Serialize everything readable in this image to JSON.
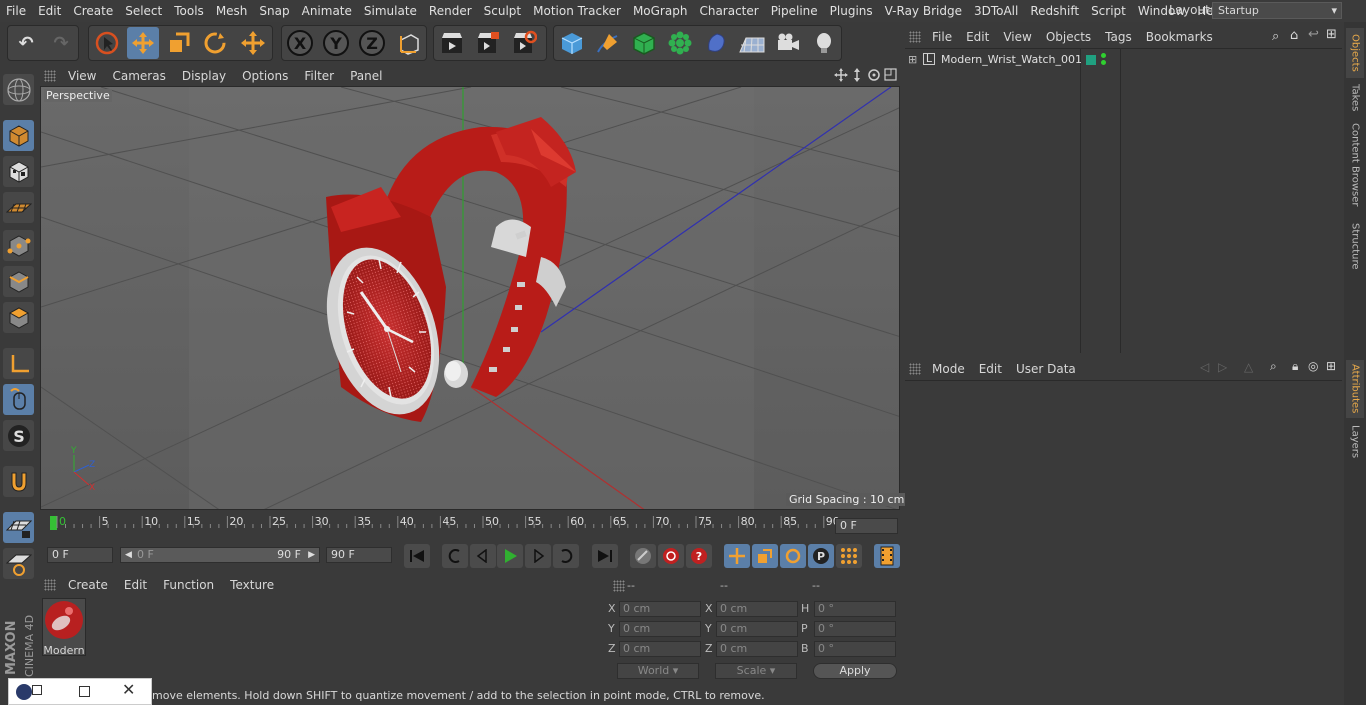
{
  "menubar": {
    "items": [
      "File",
      "Edit",
      "Create",
      "Select",
      "Tools",
      "Mesh",
      "Snap",
      "Animate",
      "Simulate",
      "Render",
      "Sculpt",
      "Motion Tracker",
      "MoGraph",
      "Character",
      "Pipeline",
      "Plugins",
      "V-Ray Bridge",
      "3DToAll",
      "Redshift",
      "Script",
      "Window",
      "Help"
    ],
    "layout_label": "Layout:",
    "layout_value": "Startup"
  },
  "viewport": {
    "menu": [
      "View",
      "Cameras",
      "Display",
      "Options",
      "Filter",
      "Panel"
    ],
    "camera_label": "Perspective",
    "grid_spacing": "Grid Spacing : 10 cm"
  },
  "timeline": {
    "ticks": [
      "0",
      "5",
      "10",
      "15",
      "20",
      "25",
      "30",
      "35",
      "40",
      "45",
      "50",
      "55",
      "60",
      "65",
      "70",
      "75",
      "80",
      "85",
      "90"
    ],
    "current_frame": "0 F",
    "start_field": "0 F",
    "range_start": "0 F",
    "range_end": "90 F",
    "end_field": "90 F"
  },
  "materials": {
    "menu": [
      "Create",
      "Edit",
      "Function",
      "Texture"
    ],
    "items": [
      {
        "name": "Modern"
      }
    ]
  },
  "coords": {
    "headers": [
      "--",
      "--",
      "--"
    ],
    "rows": [
      {
        "a": "X",
        "av": "0 cm",
        "b": "X",
        "bv": "0 cm",
        "c": "H",
        "cv": "0 °"
      },
      {
        "a": "Y",
        "av": "0 cm",
        "b": "Y",
        "bv": "0 cm",
        "c": "P",
        "cv": "0 °"
      },
      {
        "a": "Z",
        "av": "0 cm",
        "b": "Z",
        "bv": "0 cm",
        "c": "B",
        "cv": "0 °"
      }
    ],
    "world": "World",
    "scale": "Scale",
    "apply": "Apply"
  },
  "objects": {
    "menu": [
      "File",
      "Edit",
      "View",
      "Objects",
      "Tags",
      "Bookmarks"
    ],
    "items": [
      {
        "name": "Modern_Wrist_Watch_001"
      }
    ]
  },
  "attributes": {
    "menu": [
      "Mode",
      "Edit",
      "User Data"
    ]
  },
  "side_tabs": [
    "Objects",
    "Takes",
    "Content Browser",
    "Structure",
    "Attributes",
    "Layers"
  ],
  "status": {
    "text": "move elements. Hold down SHIFT to quantize movement / add to the selection in point mode, CTRL to remove."
  },
  "brand": {
    "line1": "MAXON",
    "line2": "CINEMA 4D"
  },
  "colors": {
    "accent": "#5b7fa8",
    "watch_red": "#c0201c",
    "active_tab": "#e8a94a"
  }
}
